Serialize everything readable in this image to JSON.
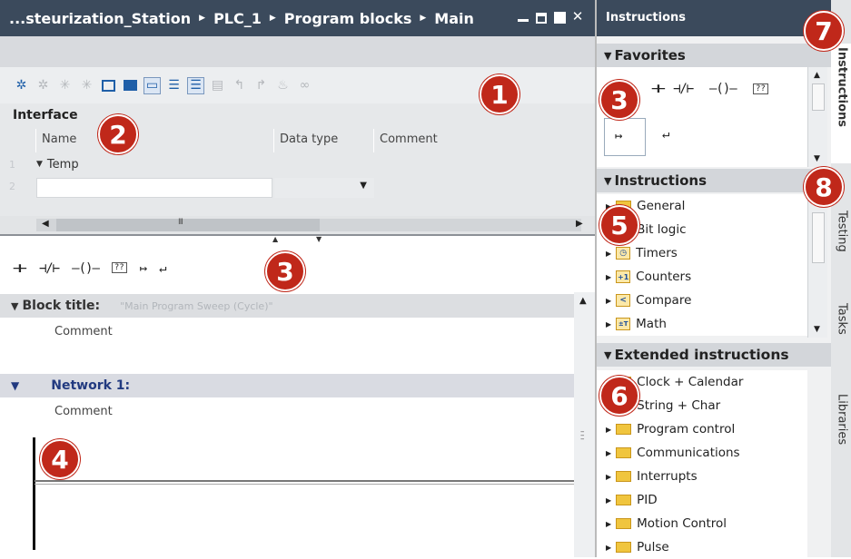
{
  "editor": {
    "breadcrumb": [
      "...steurization_Station",
      "PLC_1",
      "Program blocks",
      "Main"
    ],
    "interface_title": "Interface",
    "columns": [
      "Name",
      "Data type",
      "Comment"
    ],
    "rows": [
      {
        "num": "1",
        "name": "Temp"
      },
      {
        "num": "2",
        "name": ""
      }
    ],
    "ladder_toolbar": [
      "⊣⊢",
      "⊣/⊢",
      "–()–",
      "??",
      "↦",
      "↵"
    ],
    "block_title_label": "Block title:",
    "block_title_value": "\"Main Program Sweep (Cycle)\"",
    "comment1": "Comment",
    "network_label": "Network 1:",
    "comment2": "Comment",
    "hscroll_grip": "III"
  },
  "task_card": {
    "header": "Instructions",
    "favorites": {
      "title": "Favorites",
      "items": [
        "⊣⊢",
        "⊣/⊢",
        "–()–",
        "??",
        "↦",
        "↵"
      ]
    },
    "instructions": {
      "title": "Instructions",
      "items": [
        {
          "label": "General",
          "icon": "folder-icon"
        },
        {
          "label": "Bit logic",
          "icon": "folder-icon"
        },
        {
          "label": "Timers",
          "icon": "timer-icon",
          "glyph": "◷"
        },
        {
          "label": "Counters",
          "icon": "counter-icon",
          "glyph": "+1"
        },
        {
          "label": "Compare",
          "icon": "compare-icon",
          "glyph": "<"
        },
        {
          "label": "Math",
          "icon": "math-icon",
          "glyph": "±T"
        }
      ]
    },
    "extended": {
      "title": "Extended instructions",
      "items": [
        "Clock + Calendar",
        "String + Char",
        "Program control",
        "Communications",
        "Interrupts",
        "PID",
        "Motion Control",
        "Pulse"
      ]
    },
    "side_tabs": [
      "Instructions",
      "Testing",
      "Tasks",
      "Libraries"
    ]
  },
  "callouts": [
    "1",
    "2",
    "3",
    "3",
    "4",
    "5",
    "6",
    "7",
    "8"
  ],
  "colors": {
    "title_bar": "#3b4a5c",
    "callout": "#c0281a",
    "network_label": "#223a80"
  }
}
